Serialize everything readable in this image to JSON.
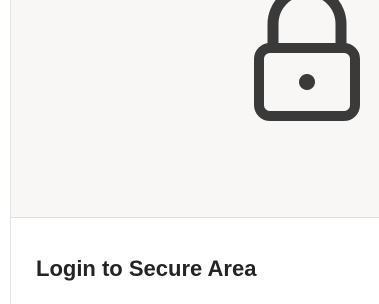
{
  "card": {
    "icon": "lock-icon",
    "title": "Login to Secure Area"
  },
  "colors": {
    "media_background": "#f8f7f5",
    "icon_stroke": "#3a3a3a",
    "title_text": "#252423",
    "divider": "#e2dfdb"
  }
}
